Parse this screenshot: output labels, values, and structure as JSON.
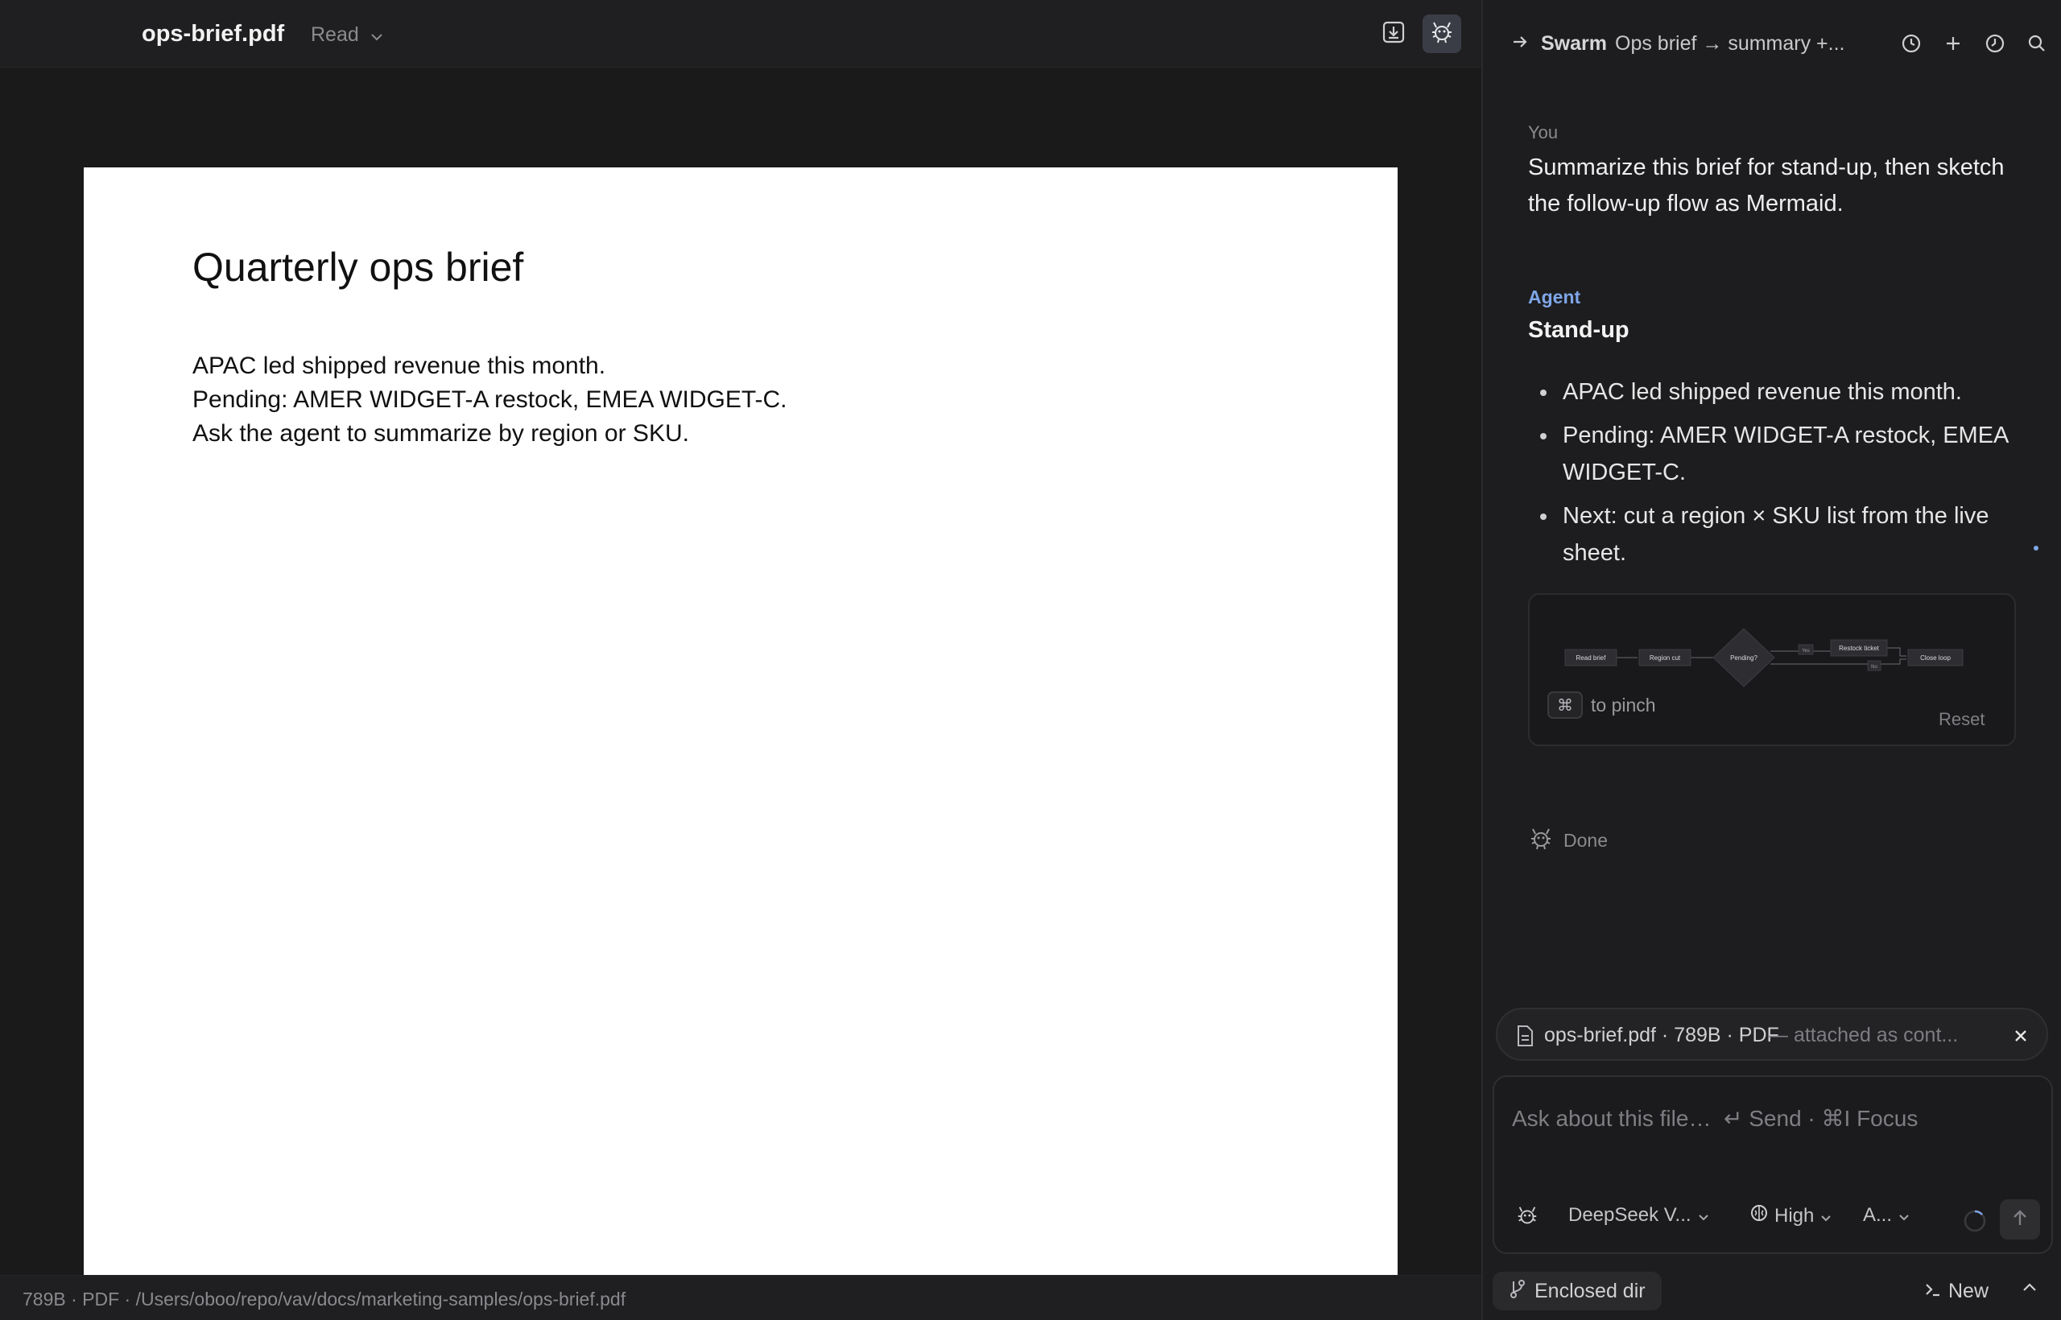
{
  "topbar": {
    "doc_title": "ops-brief.pdf",
    "mode_label": "Read",
    "icons": [
      "export-icon",
      "agent-icon"
    ]
  },
  "document": {
    "heading": "Quarterly ops brief",
    "lines": [
      "APAC led shipped revenue this month.",
      "Pending: AMER WIDGET-A restock, EMEA WIDGET-C.",
      "Ask the agent to summarize by region or SKU."
    ]
  },
  "statusbar": {
    "text": "789B · PDF · /Users/oboo/repo/vav/docs/marketing-samples/ops-brief.pdf"
  },
  "chat": {
    "header": {
      "swarm_label": "Swarm",
      "thread_title": "Ops brief → summary +...",
      "icons": [
        "history-icon",
        "plus-icon",
        "clock-icon",
        "search-icon"
      ]
    },
    "user": {
      "label": "You",
      "message": "Summarize this brief for stand-up, then sketch the follow-up flow as Mermaid."
    },
    "agent": {
      "label": "Agent",
      "heading": "Stand-up",
      "bullets": [
        "APAC led shipped revenue this month.",
        "Pending: AMER WIDGET-A restock, EMEA WIDGET-C.",
        "Next: cut a region × SKU list from the live sheet."
      ]
    },
    "diagram": {
      "nodes": {
        "read_brief": "Read brief",
        "region_cut": "Region cut",
        "pending": "Pending?",
        "restock_ticket": "Restock ticket",
        "close_loop": "Close loop"
      },
      "edges": {
        "yes": "Yes",
        "no": "No"
      },
      "pinch_key": "⌘",
      "pinch_hint": "to pinch",
      "reset_label": "Reset"
    },
    "status": {
      "done_label": "Done"
    },
    "attachment": {
      "name": "ops-brief.pdf · 789B · PDF",
      "note": "— attached as cont..."
    },
    "composer": {
      "placeholder": "Ask about this file…  ↵ Send · ⌘I Focus",
      "model": "DeepSeek V...",
      "effort": "High",
      "mode": "A..."
    },
    "bottom": {
      "enclosed_label": "Enclosed dir",
      "new_label": "New"
    }
  }
}
